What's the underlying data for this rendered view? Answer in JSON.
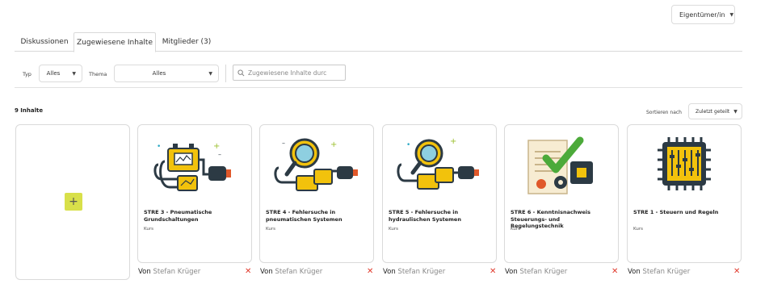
{
  "header": {
    "role_label": "Eigentümer/in"
  },
  "tabs": [
    {
      "label": "Diskussionen"
    },
    {
      "label": "Zugewiesene Inhalte"
    },
    {
      "label": "Mitglieder (3)"
    }
  ],
  "filters": {
    "type_label": "Typ",
    "type_value": "Alles",
    "theme_label": "Thema",
    "theme_value": "Alles",
    "search_placeholder": "Zugewiesene Inhalte durc"
  },
  "content": {
    "count_label": "9 Inhalte",
    "sort_label": "Sortieren nach",
    "sort_value": "Zuletzt geteilt",
    "add_label": "+"
  },
  "cards": [
    {
      "title": "STRE 3 - Pneumatische Grundschaltungen",
      "type": "Kurs",
      "author_prefix": "Von",
      "author": "Stefan Krüger",
      "icon": "pneumatic-circuit-icon"
    },
    {
      "title": "STRE 4 - Fehlersuche in pneumatischen Systemen",
      "type": "Kurs",
      "author_prefix": "Von",
      "author": "Stefan Krüger",
      "icon": "pneumatic-troubleshooting-icon"
    },
    {
      "title": "STRE 5 - Fehlersuche in hydraulischen Systemen",
      "type": "Kurs",
      "author_prefix": "Von",
      "author": "Stefan Krüger",
      "icon": "hydraulic-troubleshooting-icon"
    },
    {
      "title": "STRE 6 - Kenntnisnachweis Steuerungs- und Regelungstechnik",
      "type": "Kurs",
      "author_prefix": "Von",
      "author": "Stefan Krüger",
      "icon": "certificate-chip-icon"
    },
    {
      "title": "STRE 1 - Steuern und Regeln",
      "type": "Kurs",
      "author_prefix": "Von",
      "author": "Stefan Krüger",
      "icon": "control-chip-icon"
    }
  ],
  "colors": {
    "accent": "#d8e04a",
    "remove": "#e0392b",
    "icon_yellow": "#f2c20c",
    "icon_dark": "#2c3a44",
    "icon_orange": "#e0582a"
  }
}
